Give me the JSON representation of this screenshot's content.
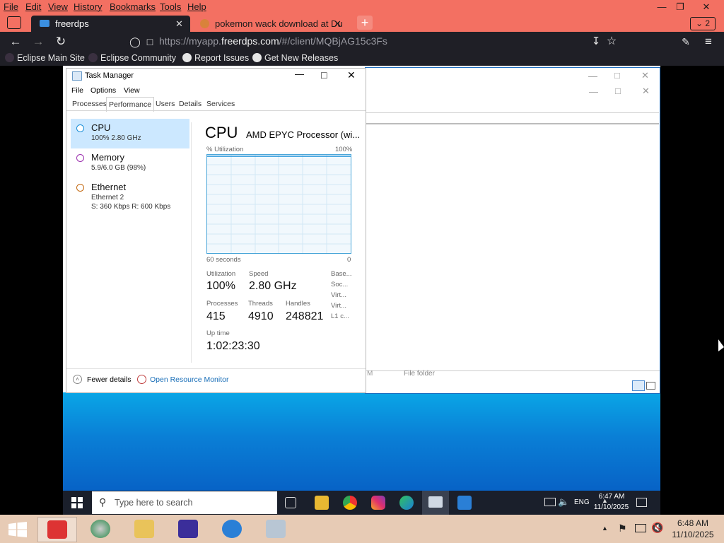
{
  "browser": {
    "menu": [
      "File",
      "Edit",
      "View",
      "History",
      "Bookmarks",
      "Tools",
      "Help"
    ],
    "tabs": [
      {
        "label": "freerdps",
        "active": true
      },
      {
        "label": "pokemon wack download at Du",
        "active": false
      }
    ],
    "tab_count": "2",
    "url_prefix": "https://myapp.",
    "url_domain": "freerdps.com",
    "url_suffix": "/#/client/MQBjAG15c3Fs",
    "bookmarks": [
      "Eclipse Main Site",
      "Eclipse Community",
      "Report Issues",
      "Get New Releases"
    ],
    "accent_color": "#f37062"
  },
  "task_manager": {
    "title": "Task Manager",
    "menu": [
      "File",
      "Options",
      "View"
    ],
    "tabs": [
      "Processes",
      "Performance",
      "Users",
      "Details",
      "Services"
    ],
    "selected_tab": "Performance",
    "sidebar": [
      {
        "name": "CPU",
        "sub1": "100%  2.80 GHz",
        "sub2": "",
        "color": "#1a8fd8"
      },
      {
        "name": "Memory",
        "sub1": "5.9/6.0 GB (98%)",
        "sub2": "",
        "color": "#9b2fae"
      },
      {
        "name": "Ethernet",
        "sub1": "Ethernet 2",
        "sub2": "S: 360 Kbps  R: 600 Kbps",
        "color": "#c46a12"
      }
    ],
    "heading": "CPU",
    "processor": "AMD EPYC Processor (wi...",
    "util_label": "% Utilization",
    "util_max": "100%",
    "time_label": "60 seconds",
    "time_min": "0",
    "stats": {
      "utilization_label": "Utilization",
      "utilization": "100%",
      "speed_label": "Speed",
      "speed": "2.80 GHz",
      "processes_label": "Processes",
      "processes": "415",
      "threads_label": "Threads",
      "threads": "4910",
      "handles_label": "Handles",
      "handles": "248821",
      "uptime_label": "Up time",
      "uptime": "1:02:23:30"
    },
    "side_details": [
      "Base...",
      "Soc...",
      "Virt...",
      "Virt...",
      "L1 c..."
    ],
    "fewer_details": "Fewer details",
    "open_resource_monitor": "Open Resource Monitor"
  },
  "background_window": {
    "status_left": "M",
    "status_text": "File folder"
  },
  "remote_taskbar": {
    "search_placeholder": "Type here to search",
    "language": "ENG",
    "time": "6:47 AM",
    "date": "11/10/2025"
  },
  "local_taskbar": {
    "time": "6:48 AM",
    "date": "11/10/2025"
  }
}
